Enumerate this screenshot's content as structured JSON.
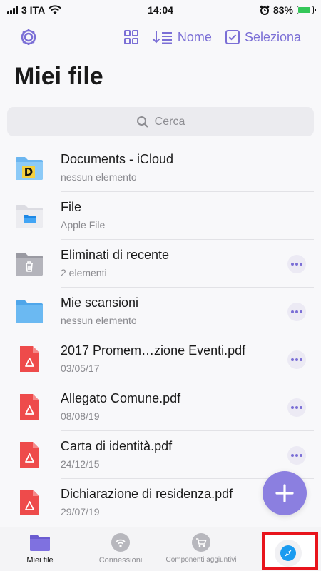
{
  "status_bar": {
    "carrier": "3 ITA",
    "time": "14:04",
    "battery": "83%",
    "battery_level": 0.83
  },
  "toolbar": {
    "settings_icon": "gear-icon",
    "grid_icon": "grid-view-icon",
    "sort_label": "Nome",
    "select_label": "Seleziona"
  },
  "page": {
    "title": "Miei file"
  },
  "search": {
    "placeholder": "Cerca"
  },
  "items": [
    {
      "title": "Documents - iCloud",
      "subtitle": "nessun elemento",
      "icon": "icloud-folder-icon",
      "more": false
    },
    {
      "title": "File",
      "subtitle": "Apple File",
      "icon": "apple-files-folder-icon",
      "more": false
    },
    {
      "title": "Eliminati di recente",
      "subtitle": "2 elementi",
      "icon": "trash-folder-icon",
      "more": true
    },
    {
      "title": "Mie scansioni",
      "subtitle": "nessun elemento",
      "icon": "folder-icon",
      "more": true
    },
    {
      "title": "2017 Promem…zione Eventi.pdf",
      "subtitle": "03/05/17",
      "icon": "pdf-icon",
      "more": true
    },
    {
      "title": "Allegato Comune.pdf",
      "subtitle": "08/08/19",
      "icon": "pdf-icon",
      "more": true
    },
    {
      "title": "Carta di identità.pdf",
      "subtitle": "24/12/15",
      "icon": "pdf-icon",
      "more": true
    },
    {
      "title": "Dichiarazione di residenza.pdf",
      "subtitle": "29/07/19",
      "icon": "pdf-icon",
      "more": false
    }
  ],
  "tabbar": {
    "tabs": [
      {
        "label": "Miei file",
        "icon": "folder-icon"
      },
      {
        "label": "Connessioni",
        "icon": "wifi-icon"
      },
      {
        "label": "Componenti aggiuntivi",
        "icon": "cart-icon"
      }
    ],
    "browser_icon": "compass-icon"
  },
  "colors": {
    "accent": "#7b6fd6",
    "fab": "#8b7fe0",
    "pdf": "#ee4b4b",
    "folder_blue": "#5ab0ee",
    "highlight": "#e8141c"
  }
}
